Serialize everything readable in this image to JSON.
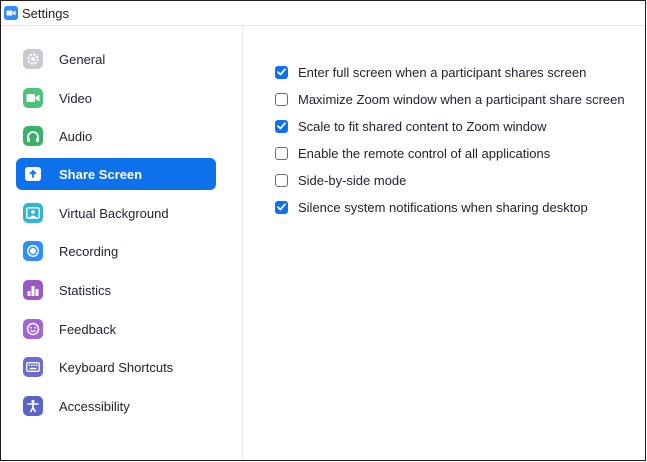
{
  "window": {
    "title": "Settings"
  },
  "colors": {
    "accent": "#0e72ed",
    "text": "#232333"
  },
  "sidebar": {
    "items": [
      {
        "label": "General",
        "icon": "gear-icon",
        "color": "#c9c9d0",
        "active": false
      },
      {
        "label": "Video",
        "icon": "video-camera-icon",
        "color": "#4cc27b",
        "active": false
      },
      {
        "label": "Audio",
        "icon": "headphones-icon",
        "color": "#38b26b",
        "active": false
      },
      {
        "label": "Share Screen",
        "icon": "share-screen-icon",
        "color": "#ffffff",
        "active": true
      },
      {
        "label": "Virtual Background",
        "icon": "person-background-icon",
        "color": "#2fb6d8",
        "active": false
      },
      {
        "label": "Recording",
        "icon": "record-icon",
        "color": "#2d8cff",
        "active": false
      },
      {
        "label": "Statistics",
        "icon": "bar-chart-icon",
        "color": "#9b59c6",
        "active": false
      },
      {
        "label": "Feedback",
        "icon": "smiley-icon",
        "color": "#a463d8",
        "active": false
      },
      {
        "label": "Keyboard Shortcuts",
        "icon": "keyboard-icon",
        "color": "#6b6ccf",
        "active": false
      },
      {
        "label": "Accessibility",
        "icon": "accessibility-icon",
        "color": "#5b65c6",
        "active": false
      }
    ]
  },
  "share_screen": {
    "options": [
      {
        "label": "Enter full screen when a participant shares screen",
        "checked": true
      },
      {
        "label": "Maximize Zoom window when a participant share screen",
        "checked": false
      },
      {
        "label": "Scale to fit shared content to Zoom window",
        "checked": true
      },
      {
        "label": "Enable the remote control of all applications",
        "checked": false
      },
      {
        "label": "Side-by-side mode",
        "checked": false
      },
      {
        "label": "Silence system notifications when sharing desktop",
        "checked": true
      }
    ]
  }
}
